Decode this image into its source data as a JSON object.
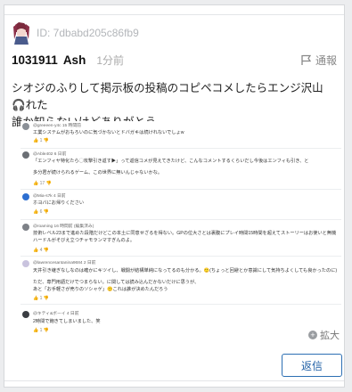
{
  "post": {
    "id_label": "ID: 7dbabd205c86fb9",
    "number": "1031911",
    "author": "Ash",
    "time": "1分前",
    "report_label": "通報",
    "body_line1": "シオジのふりして掲示板の投稿のコピペコメしたらエンジ沢山🎧れた",
    "body_line2": "誰か知らないけどありがとう"
  },
  "comments": [
    {
      "header": "@greeeen-y4c 15 時間前",
      "lines": [
        "工業システムがおもろいのに気づかないとドバガキは続けれないでしょw"
      ],
      "likes": "1",
      "avatar_color": "#8a8f96"
    },
    {
      "header": "@Able402 6 日前",
      "lines": [
        "「エンフィヤ特化たら◯攻撃引き返す▶」って返信コメが見えてきたけど、こんなコメントするくらいだし今後はエンフィも引き、と",
        "多分君が続けられるゲーム、この世界に無いんじゃないかな。"
      ],
      "likes": "17",
      "avatar_color": "#6b6f75"
    },
    {
      "header": "@Mia-s7k 4 日前",
      "lines": [
        "ホヨバにお帰りください"
      ],
      "likes": "6",
      "avatar_color": "#2d6fd1"
    },
    {
      "header": "@roaming 16 時間前 (編集済み)",
      "lines": [
        "技術レベル23まで進めた段階だけどこの本土に同意せざるを得ない。GPの位大さとは裏腹にプレイ時間15時間を超えてストーリーはお使いと無機",
        "ハードルがそびえ立つチャモランマすぎんのよ。"
      ],
      "likes": "4",
      "avatar_color": "#7d8187"
    },
    {
      "header": "@lawrencesantanina9684 2 日前",
      "lines": [
        "天井引き継ぎなしなのは確かにキツイし、戦闘が結構単純になってるのも分かる。🙂(ちょっと回避とか意識にして気持ちよくしても良かったのに)",
        "ただ、専門用語だけでつまらない。に関しては読み込んだかないだけに思うが、",
        "あと「お手軽さが売りのソシャゲ」🙂これは誰が決めたんだろう"
      ],
      "likes": "1",
      "avatar_color": "#c9c3de"
    },
    {
      "header": "@キティ&ボーイ 4 日前",
      "lines": [
        "2時間で飽きてしまいました、笑"
      ],
      "likes": "1",
      "avatar_color": "#3a3d42"
    }
  ],
  "expand_label": "拡大",
  "reply_label": "返信",
  "colors": {
    "accent": "#1f5fa6",
    "muted": "#b3b6ba"
  }
}
